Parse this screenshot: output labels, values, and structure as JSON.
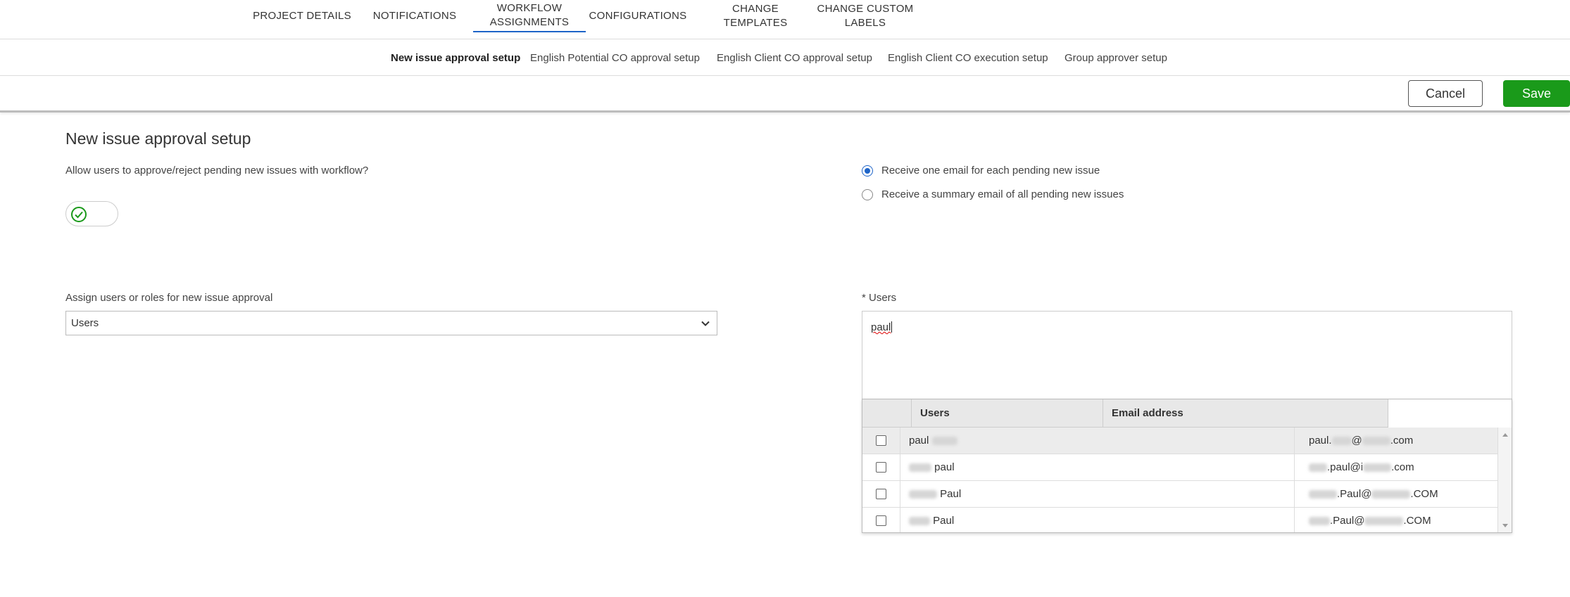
{
  "top_nav": {
    "tabs": [
      {
        "label": "PROJECT DETAILS"
      },
      {
        "label": "NOTIFICATIONS"
      },
      {
        "label": "WORKFLOW\nASSIGNMENTS",
        "active": true
      },
      {
        "label": "CONFIGURATIONS"
      },
      {
        "label": "CHANGE TEMPLATES"
      },
      {
        "label": "CHANGE CUSTOM\nLABELS"
      }
    ]
  },
  "sub_nav": {
    "tabs": [
      {
        "label": "New issue approval setup",
        "active": true
      },
      {
        "label": "English Potential CO approval setup"
      },
      {
        "label": "English Client CO approval setup"
      },
      {
        "label": "English Client CO execution setup"
      },
      {
        "label": "Group approver setup"
      }
    ]
  },
  "actions": {
    "cancel_label": "Cancel",
    "save_label": "Save"
  },
  "colors": {
    "accent": "#1e64c8",
    "save": "#1a9a1a"
  },
  "form": {
    "title": "New issue approval setup",
    "allow_question": "Allow users to approve/reject pending new issues with workflow?",
    "toggle_on": true,
    "email_options": [
      {
        "label": "Receive one email for each pending new issue",
        "checked": true
      },
      {
        "label": "Receive a summary email of all pending new issues",
        "checked": false
      }
    ],
    "assign_label": "Assign users or roles for new issue approval",
    "assign_value": "Users",
    "users_label": "* Users",
    "users_query": "paul"
  },
  "user_dropdown": {
    "headers": [
      "Users",
      "Email address"
    ],
    "rows": [
      {
        "name": "paul",
        "email_pre": "paul.",
        "email_mid": "@",
        "email_end": ".com"
      },
      {
        "name": "paul",
        "email_pre": "",
        "email_mid": ".paul@i",
        "email_end": ".com"
      },
      {
        "name": "Paul",
        "email_pre": "",
        "email_mid": ".Paul@",
        "email_end": ".COM"
      },
      {
        "name": "Paul",
        "email_pre": "",
        "email_mid": ".Paul@",
        "email_end": ".COM"
      }
    ]
  }
}
